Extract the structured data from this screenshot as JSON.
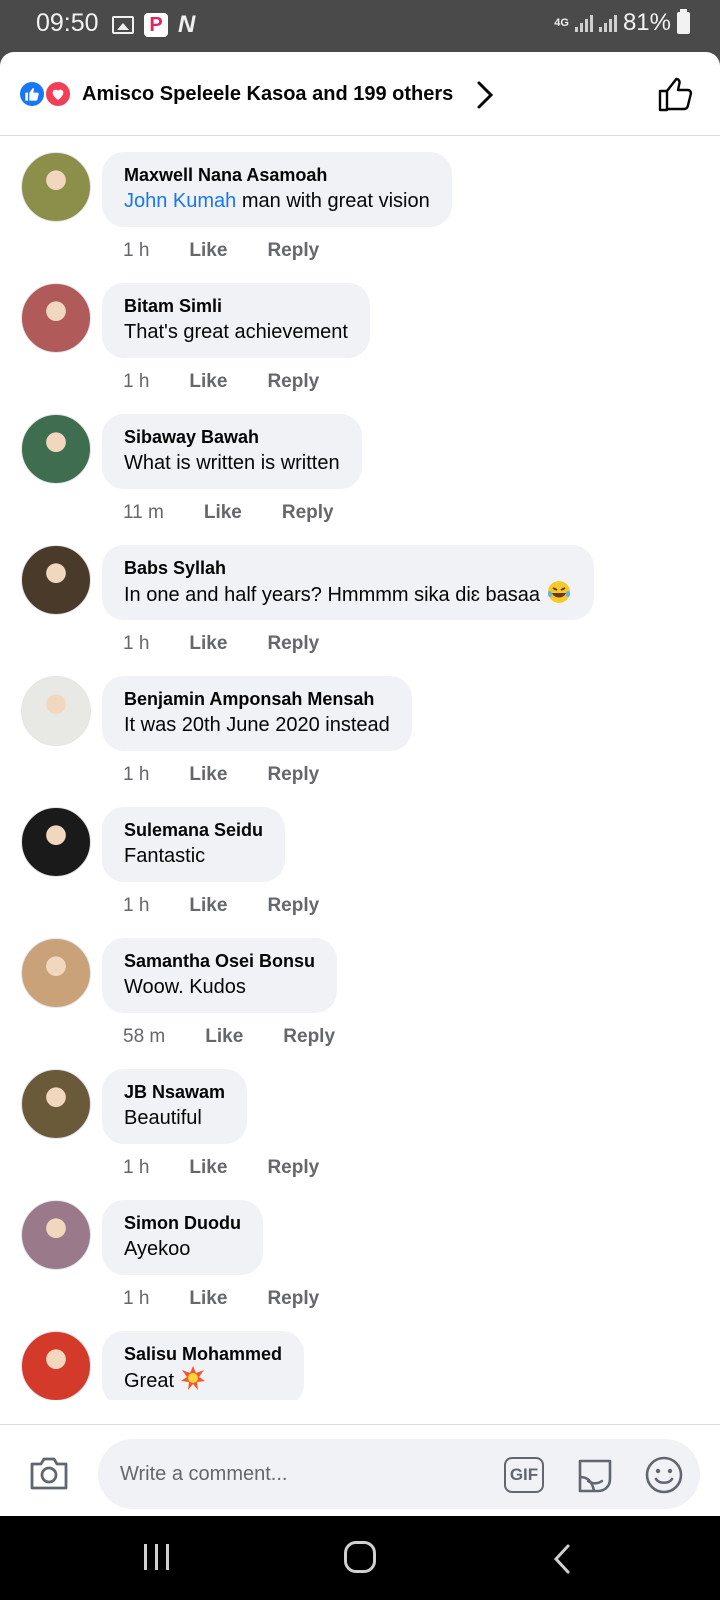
{
  "status_bar": {
    "time": "09:50",
    "network": "4G",
    "battery": "81%"
  },
  "header": {
    "reactors_text": "Amisco Speleele Kasoa and 199 others"
  },
  "comments": [
    {
      "name": "Maxwell Nana Asamoah",
      "mention": "John Kumah",
      "text": " man with great vision",
      "time": "1 h",
      "like": "Like",
      "reply": "Reply",
      "avatar_color": "#8b8f4a"
    },
    {
      "name": "Bitam Simli",
      "mention": "",
      "text": "That's great achievement",
      "time": "1 h",
      "like": "Like",
      "reply": "Reply",
      "avatar_color": "#b05a5a"
    },
    {
      "name": "Sibaway Bawah",
      "mention": "",
      "text": "What is written is written",
      "time": "11 m",
      "like": "Like",
      "reply": "Reply",
      "avatar_color": "#3f6d4f"
    },
    {
      "name": "Babs Syllah",
      "mention": "",
      "text": "In one and half years? Hmmmm sika diɛ basaa",
      "time": "1 h",
      "like": "Like",
      "reply": "Reply",
      "avatar_color": "#4a3a2a"
    },
    {
      "name": "Benjamin Amponsah Mensah",
      "mention": "",
      "text": "It was 20th June 2020 instead",
      "time": "1 h",
      "like": "Like",
      "reply": "Reply",
      "avatar_color": "#e8e8e4"
    },
    {
      "name": "Sulemana Seidu",
      "mention": "",
      "text": "Fantastic",
      "time": "1 h",
      "like": "Like",
      "reply": "Reply",
      "avatar_color": "#1a1a1a"
    },
    {
      "name": "Samantha Osei Bonsu",
      "mention": "",
      "text": "Woow. Kudos",
      "time": "58 m",
      "like": "Like",
      "reply": "Reply",
      "avatar_color": "#c9a27a"
    },
    {
      "name": "JB Nsawam",
      "mention": "",
      "text": "Beautiful",
      "time": "1 h",
      "like": "Like",
      "reply": "Reply",
      "avatar_color": "#6b5a3a"
    },
    {
      "name": "Simon Duodu",
      "mention": "",
      "text": "Ayekoo",
      "time": "1 h",
      "like": "Like",
      "reply": "Reply",
      "avatar_color": "#9a7a8a"
    },
    {
      "name": "Salisu Mohammed",
      "mention": "",
      "text": "Great ",
      "time": "",
      "like": "",
      "reply": "",
      "avatar_color": "#d43a2a"
    }
  ],
  "composer": {
    "placeholder": "Write a comment...",
    "gif_label": "GIF"
  },
  "colors": {
    "like_blue": "#1877f2",
    "love_red": "#f33e58",
    "bubble": "#f0f2f5",
    "meta_grey": "#65676b"
  },
  "icons": [
    "image-icon",
    "p-app-icon",
    "n-app-icon",
    "like-reaction-icon",
    "love-reaction-icon",
    "chevron-right-icon",
    "thumbs-up-icon",
    "camera-icon",
    "gif-icon",
    "sticker-icon",
    "emoji-icon",
    "recents-icon",
    "home-icon",
    "back-icon"
  ]
}
